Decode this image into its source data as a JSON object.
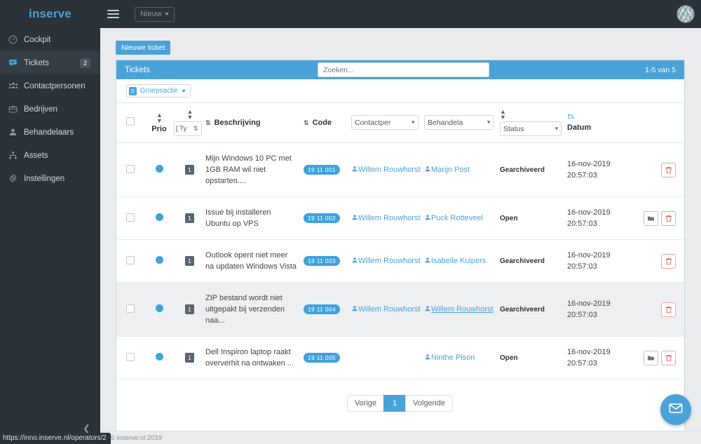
{
  "topbar": {
    "brand": "inserve",
    "menu_icon": "hamburger-icon",
    "new_button": "Nieuw",
    "avatar_icon": "user-avatar-identicon"
  },
  "sidebar": {
    "items": [
      {
        "label": "Cockpit",
        "icon": "speedometer-icon",
        "active": false,
        "badge": ""
      },
      {
        "label": "Tickets",
        "icon": "comment-icon",
        "active": true,
        "badge": "2"
      },
      {
        "label": "Contactpersonen",
        "icon": "users-group-icon",
        "active": false,
        "badge": ""
      },
      {
        "label": "Bedrijven",
        "icon": "briefcase-icon",
        "active": false,
        "badge": ""
      },
      {
        "label": "Behandelaars",
        "icon": "user-icon",
        "active": false,
        "badge": ""
      },
      {
        "label": "Assets",
        "icon": "sitemap-icon",
        "active": false,
        "badge": ""
      },
      {
        "label": "Instellingen",
        "icon": "gear-icon",
        "active": false,
        "badge": ""
      }
    ],
    "collapse_icon": "chevron-left-icon"
  },
  "statusbar": {
    "url": "https://inno.inserve.nl/operators/2"
  },
  "content": {
    "new_ticket_button": "Nieuwe ticket",
    "panel_title": "Tickets",
    "search_placeholder": "Zoeken...",
    "result_count": "1-5 van 5",
    "group_action": {
      "count": "0",
      "label": "Groepsactie"
    }
  },
  "table": {
    "headers": {
      "select_all": "",
      "prio": "Prio",
      "type": "[ Ty",
      "beschrijving": "Beschrijving",
      "code": "Code",
      "contactpersoon": "Contactper",
      "behandelaar": "Behandela",
      "status": "Status",
      "datum": "Datum"
    },
    "rows": [
      {
        "prio": "blue-dot",
        "type": "1",
        "beschrijving": "Mijn Windows 10 PC met 1GB RAM wil niet opstarten....",
        "code": "19 11 001",
        "contactpersoon": "Willem Rouwhorst",
        "contact_underline": false,
        "behandelaar": "Marijn Post",
        "behandelaar_underline": false,
        "status": "Gearchiveerd",
        "datum": "16-nov-2019 20:57:03",
        "has_folder": false,
        "has_trash": true,
        "alt": false
      },
      {
        "prio": "blue-dot",
        "type": "1",
        "beschrijving": "Issue bij installeren Ubuntu op VPS",
        "code": "19 11 002",
        "contactpersoon": "Willem Rouwhorst",
        "contact_underline": false,
        "behandelaar": "Puck Rotteveel",
        "behandelaar_underline": false,
        "status": "Open",
        "datum": "16-nov-2019 20:57:03",
        "has_folder": true,
        "has_trash": true,
        "alt": false
      },
      {
        "prio": "blue-dot",
        "type": "1",
        "beschrijving": "Outlook opent niet meer na updaten Windows Vista",
        "code": "19 11 003",
        "contactpersoon": "Willem Rouwhorst",
        "contact_underline": false,
        "behandelaar": "Isabelle Kuipers",
        "behandelaar_underline": false,
        "status": "Gearchiveerd",
        "datum": "16-nov-2019 20:57:03",
        "has_folder": false,
        "has_trash": true,
        "alt": false
      },
      {
        "prio": "blue-dot",
        "type": "1",
        "beschrijving": "ZIP bestand wordt niet uitgepakt bij verzenden naa...",
        "code": "19 11 004",
        "contactpersoon": "Willem Rouwhorst",
        "contact_underline": false,
        "behandelaar": "Willem Rouwhorst",
        "behandelaar_underline": true,
        "status": "Gearchiveerd",
        "datum": "16-nov-2019 20:57:03",
        "has_folder": false,
        "has_trash": true,
        "alt": true
      },
      {
        "prio": "blue-dot",
        "type": "1",
        "beschrijving": "Dell Inspiron laptop raakt oververhit na ontwaken ...",
        "code": "19 11 005",
        "contactpersoon": "",
        "contact_underline": false,
        "behandelaar": "Ninthe Pison",
        "behandelaar_underline": false,
        "status": "Open",
        "datum": "16-nov-2019 20:57:03",
        "has_folder": true,
        "has_trash": true,
        "alt": false
      }
    ]
  },
  "pagination": {
    "prev": "Vorige",
    "current": "1",
    "next": "Volgende"
  },
  "footer": {
    "copyright": "© inserve.nl 2019"
  },
  "fab": {
    "icon": "envelope-icon"
  },
  "colors": {
    "brand_blue": "#4aa3d8",
    "sidebar_dark": "#2b3238",
    "page_bg": "#e9ebed",
    "danger_red": "#e2574c"
  }
}
